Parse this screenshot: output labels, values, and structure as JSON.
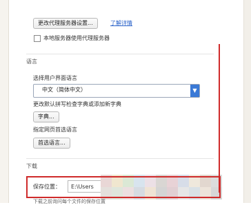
{
  "proxy": {
    "change_button": "更改代理服务器设置...",
    "learn_more": "了解详情",
    "local_checkbox_label": "本地服务器使用代理服务器"
  },
  "language": {
    "section_title": "语言",
    "ui_language_label": "选择用户界面语言",
    "ui_language_value": "中文（简体中文）",
    "dictionary_desc": "更改默认拼写检查字典或添加新字典",
    "dictionary_button": "字典...",
    "preferred_label": "指定网页首选语言",
    "preferred_button": "首选语言..."
  },
  "download": {
    "section_title": "下载",
    "save_location_label": "保存位置：",
    "save_location_value": "E:\\Users",
    "bottom_option": "下载之前询问每个文件的保存位置"
  },
  "colors": {
    "accent": "#3a79d6",
    "annotation": "#cf2a2a"
  }
}
